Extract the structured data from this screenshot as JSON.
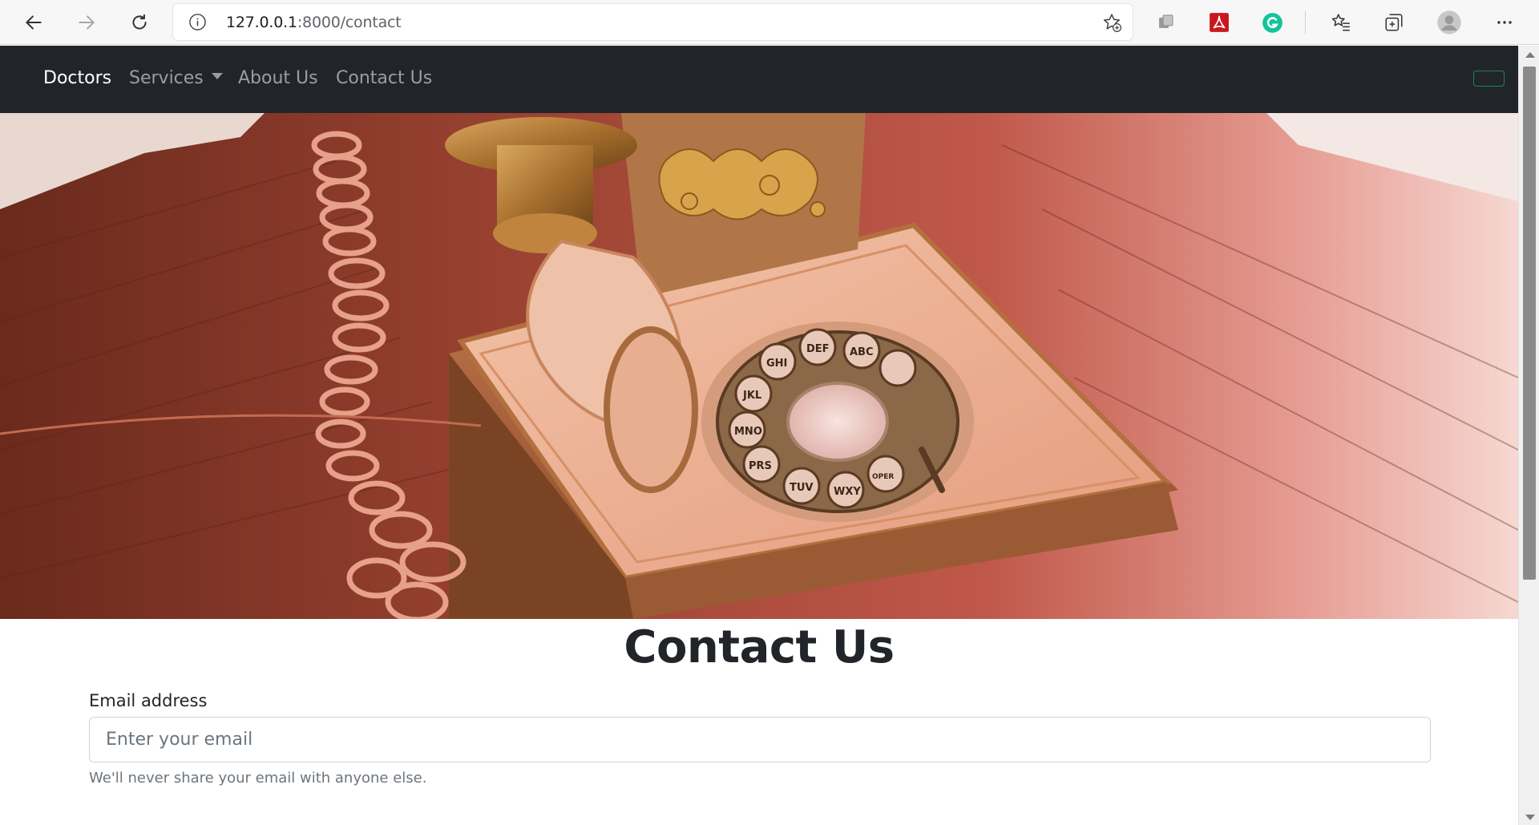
{
  "browser": {
    "url_host": "127.0.0.1",
    "url_rest": ":8000/contact",
    "colors": {
      "pdf_ext": "#c8181e",
      "grammarly_ext": "#15c39a"
    },
    "icons": [
      "back-icon",
      "forward-icon",
      "reload-icon",
      "info-icon",
      "add-favorite-icon",
      "extension-icon",
      "pdf-icon",
      "grammarly-icon",
      "favorites-icon",
      "collections-icon",
      "profile-icon",
      "more-icon"
    ]
  },
  "navbar": {
    "items": [
      {
        "label": "Doctors",
        "active": true
      },
      {
        "label": "Services",
        "dropdown": true
      },
      {
        "label": "About Us"
      },
      {
        "label": "Contact Us"
      }
    ],
    "background": "#212529",
    "toggle_color": "#198754"
  },
  "hero": {
    "image": "vintage-rotary-telephone-photo",
    "dial_letters": [
      "GHI",
      "DEF",
      "ABC",
      "JKL",
      "MNO",
      "PRS",
      "TUV",
      "WXY",
      "OPER"
    ]
  },
  "contact": {
    "title": "Contact Us",
    "email_label": "Email address",
    "email_placeholder": "Enter your email",
    "email_value": "",
    "email_help": "We'll never share your email with anyone else."
  }
}
